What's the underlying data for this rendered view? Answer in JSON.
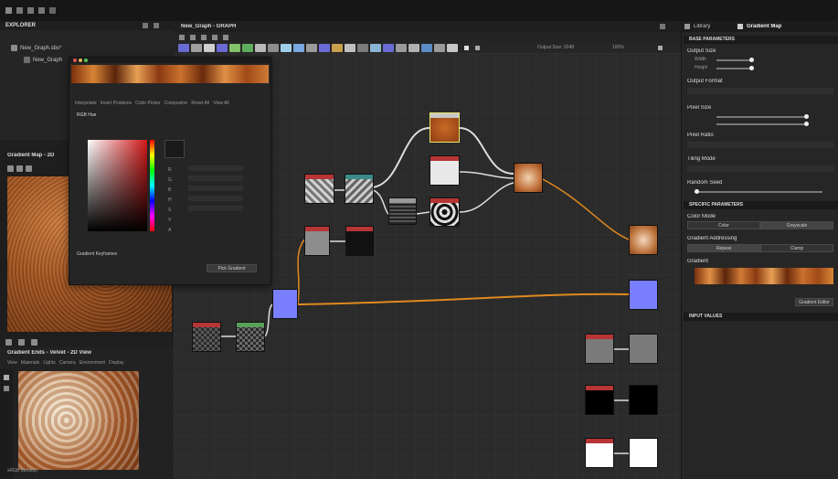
{
  "left_top": {
    "title": "EXPLORER",
    "item1": "New_Graph.sbs*",
    "item2": "New_Graph"
  },
  "graph_tab": {
    "label": "New_Graph - GRAPH"
  },
  "toolbar": {
    "resolution_label": "Output Size: 2048",
    "zoom": "100%"
  },
  "right_tabs": {
    "tab1": "Library",
    "tab2": "Gradient Map"
  },
  "props": {
    "base_title": "BASE PARAMETERS",
    "output_size": "Output Size",
    "width": "Width",
    "height": "Height",
    "output_format": "Output Format",
    "pixel_size": "Pixel Size",
    "pixel_ratio": "Pixel Ratio",
    "tiling_mode": "Tiling Mode",
    "random_seed": "Random Seed",
    "specific_title": "SPECIFIC PARAMETERS",
    "color_mode": "Color Mode",
    "color_btn": "Color",
    "grayscale_btn": "Grayscale",
    "gradient_addressing": "Gradient Addressing",
    "repeat_btn": "Repeat",
    "clamp_btn": "Clamp",
    "gradient": "Gradient",
    "gradient_editor_btn": "Gradient Editor",
    "input_title": "INPUT VALUES"
  },
  "gradient_editor": {
    "tabs": [
      "Interpolate",
      "Invert Positions",
      "Color Picker",
      "Compositor",
      "Reset All",
      "View All"
    ],
    "mode": "RGB Hue",
    "channels": [
      "R",
      "G",
      "B",
      "H",
      "S",
      "V",
      "A"
    ],
    "key_label": "Gradient Keyframes",
    "picker_btn": "Pick Gradient"
  },
  "view2d_top": {
    "title": "Gradient Map - 2D"
  },
  "view2d_bottom": {
    "title": "Gradient Ends - Velvet - 2D View",
    "menu": [
      "View",
      "Materials",
      "Lights",
      "Camera",
      "Environment",
      "Display"
    ],
    "status": "sRGB (default)"
  },
  "colors": {
    "accent": "#e08a1e",
    "normal": "#7a7fff",
    "panel": "#262626",
    "header": "#1e1e1e"
  }
}
